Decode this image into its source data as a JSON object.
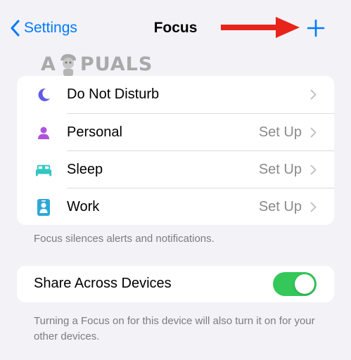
{
  "nav": {
    "back_label": "Settings",
    "title": "Focus",
    "add_icon": "plus-icon",
    "back_icon": "chevron-left-icon"
  },
  "watermark": {
    "text_left": "A",
    "text_right": "PUALS"
  },
  "focus_list": {
    "items": [
      {
        "label": "Do Not Disturb",
        "detail": "",
        "icon": "moon-icon",
        "icon_color": "#5e5ce6"
      },
      {
        "label": "Personal",
        "detail": "Set Up",
        "icon": "person-icon",
        "icon_color": "#af52de"
      },
      {
        "label": "Sleep",
        "detail": "Set Up",
        "icon": "bed-icon",
        "icon_color": "#30c6c0"
      },
      {
        "label": "Work",
        "detail": "Set Up",
        "icon": "badge-icon",
        "icon_color": "#2ea7d8"
      }
    ],
    "footnote": "Focus silences alerts and notifications."
  },
  "share": {
    "label": "Share Across Devices",
    "enabled": true,
    "footnote": "Turning a Focus on for this device will also turn it on for your other devices."
  },
  "colors": {
    "accent": "#007aff",
    "toggle_on": "#34c759",
    "annotation_arrow": "#e8231a",
    "background": "#f2f2f7"
  }
}
